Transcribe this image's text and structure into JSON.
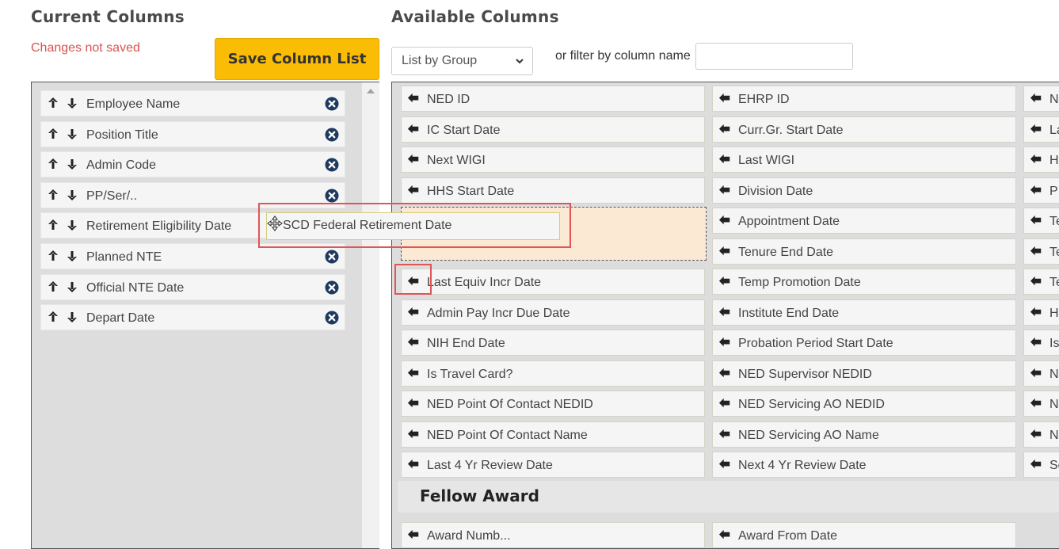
{
  "current": {
    "title": "Current Columns",
    "unsaved_msg": "Changes not saved",
    "save_label": "Save Column List",
    "items": [
      {
        "label": "Employee Name"
      },
      {
        "label": "Position Title"
      },
      {
        "label": "Admin Code"
      },
      {
        "label": "PP/Ser/.."
      },
      {
        "label": "Retirement Eligibility Date"
      },
      {
        "label": "Planned NTE"
      },
      {
        "label": "Official NTE Date"
      },
      {
        "label": "Depart Date"
      }
    ]
  },
  "available": {
    "title": "Available Columns",
    "select_value": "List by Group",
    "filter_label": "or filter by column name",
    "filter_value": "",
    "col1": [
      "NED ID",
      "IC Start Date",
      "Next WIGI",
      "HHS Start Date",
      "Last Equiv Incr Date",
      "Admin Pay Incr Due Date",
      "NIH End Date",
      "Is Travel Card?",
      "NED Point Of Contact NEDID",
      "NED Point Of Contact Name",
      "Last 4 Yr Review Date"
    ],
    "col2": [
      "EHRP ID",
      "Curr.Gr. Start Date",
      "Last WIGI",
      "Division Date",
      "Appointment Date",
      "Tenure End Date",
      "Temp Promotion Date",
      "Institute End Date",
      "Probation Period Start Date",
      "NED Supervisor NEDID",
      "NED Servicing AO NEDID",
      "NED Servicing AO Name",
      "Next 4 Yr Review Date"
    ],
    "col3": [
      "N",
      "La",
      "H",
      "P",
      "Te",
      "Te",
      "Te",
      "H",
      "Is",
      "N",
      "N",
      "N",
      "Sc"
    ],
    "group_header": "Fellow Award",
    "next_group_col1": "Award Numb...",
    "next_group_col2": "Award From Date"
  },
  "dragging": {
    "label": "SCD Federal Retirement Date"
  },
  "icons": [
    "arrow-up-icon",
    "arrow-down-icon",
    "remove-circle-icon",
    "arrow-left-icon",
    "chevron-down-icon",
    "move-cursor-icon"
  ],
  "colors": {
    "accent": "#fbbc05",
    "warning_text": "#d9534f",
    "placeholder_bg": "#fbe9d4",
    "highlight": "#e05555"
  }
}
